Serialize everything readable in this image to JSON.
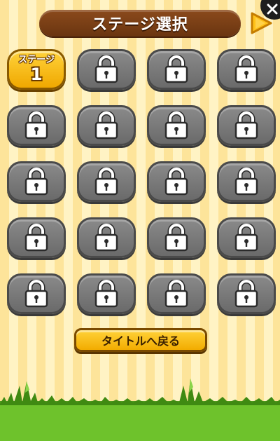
{
  "header": {
    "title": "ステージ選択",
    "next_icon": "triangle-right-icon",
    "close_icon": "close-x-icon"
  },
  "stages": {
    "current": {
      "label": "ステージ",
      "number": "1"
    },
    "locked_icon": "lock-icon",
    "locked_count": 19
  },
  "footer": {
    "back_label": "タイトルへ戻る"
  },
  "colors": {
    "accent": "#f5b400",
    "banner": "#7a3f15",
    "locked": "#7a7a7a",
    "grass": "#6ec22c"
  }
}
